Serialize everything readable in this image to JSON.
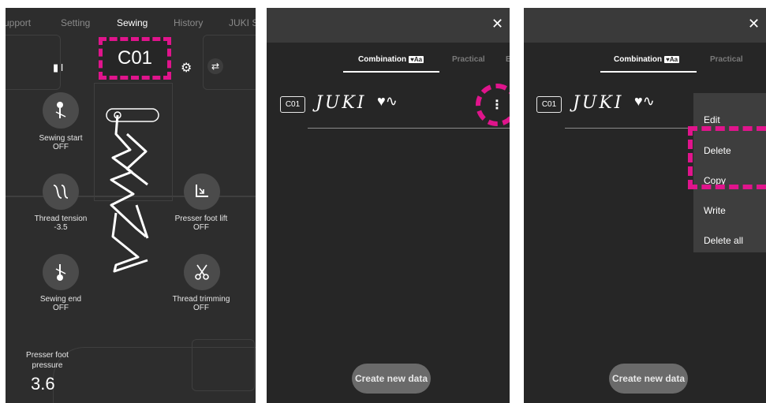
{
  "panel1": {
    "tabs": [
      "upport",
      "Setting",
      "Sewing",
      "History",
      "JUKI S"
    ],
    "pattern_code": "C01",
    "settings": {
      "sewing_start": {
        "label": "Sewing start",
        "value": "OFF"
      },
      "thread_tension": {
        "label": "Thread tension",
        "value": "-3.5"
      },
      "presser_foot_lift": {
        "label": "Presser foot lift",
        "value": "OFF"
      },
      "sewing_end": {
        "label": "Sewing end",
        "value": "OFF"
      },
      "thread_trimming": {
        "label": "Thread trimming",
        "value": "OFF"
      }
    },
    "pressure_label": "Presser foot pressure",
    "pressure_value": "3.6"
  },
  "panel2": {
    "tabs": [
      "Combination",
      "Practical",
      "E"
    ],
    "heart_badge": "Aa",
    "pattern_code": "C01",
    "pattern_text": "JUKI",
    "create_label": "Create new data"
  },
  "panel3": {
    "tabs": [
      "Combination",
      "Practical"
    ],
    "heart_badge": "Aa",
    "pattern_code": "C01",
    "pattern_text": "JUKI",
    "menu": [
      "Edit",
      "Delete",
      "Copy",
      "Write",
      "Delete all"
    ],
    "create_label": "Create new data"
  },
  "colors": {
    "highlight": "#e0148c",
    "panel_bg": "#2d2d2d",
    "button_bg": "#4b4b4b"
  },
  "icons": [
    "close-icon",
    "gear-icon",
    "more-vertical-icon",
    "needle-icon",
    "scissors-icon"
  ]
}
